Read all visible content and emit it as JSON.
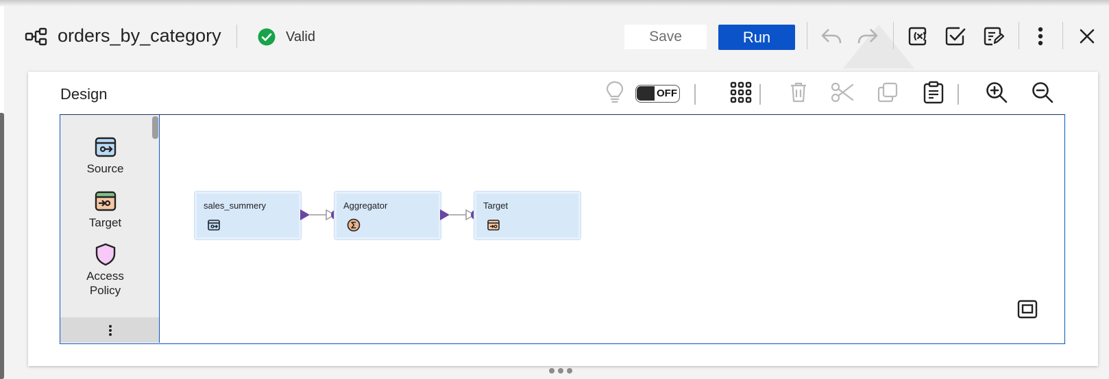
{
  "header": {
    "title": "orders_by_category",
    "status": "Valid",
    "save_label": "Save",
    "run_label": "Run",
    "icons": [
      "mapping-icon",
      "valid-check-icon",
      "undo-icon",
      "redo-icon",
      "parameters-icon",
      "validate-icon",
      "edit-properties-icon",
      "more-vertical-icon",
      "close-icon"
    ]
  },
  "design": {
    "title": "Design",
    "toggle_label": "OFF",
    "toolbar_icons": [
      "lightbulb-icon",
      "grid-icon",
      "delete-icon",
      "cut-icon",
      "copy-icon",
      "paste-icon",
      "zoom-in-icon",
      "zoom-out-icon"
    ]
  },
  "palette": {
    "items": [
      {
        "label": "Source",
        "icon": "source-icon"
      },
      {
        "label": "Target",
        "icon": "target-icon"
      },
      {
        "label": "Access Policy",
        "line1": "Access",
        "line2": "Policy",
        "icon": "shield-icon"
      }
    ]
  },
  "canvas": {
    "nodes": [
      {
        "label": "sales_summery",
        "icon": "source-icon"
      },
      {
        "label": "Aggregator",
        "icon": "sigma-icon"
      },
      {
        "label": "Target",
        "icon": "target-icon"
      }
    ]
  },
  "colors": {
    "accent": "#0b53c9",
    "valid": "#17a34a",
    "node_fill": "#d7e8f9",
    "port": "#6b46a3"
  }
}
